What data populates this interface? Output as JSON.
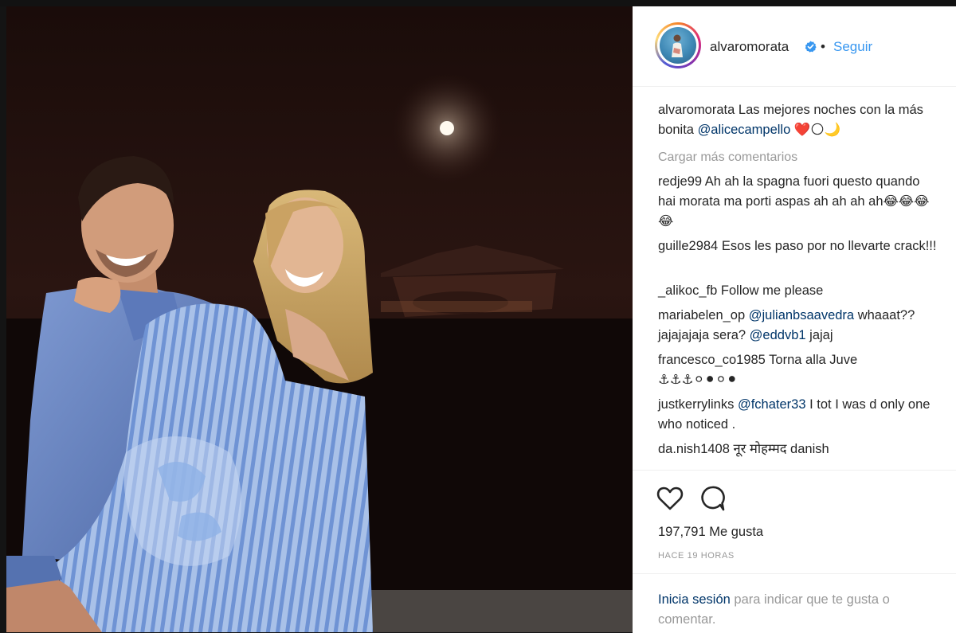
{
  "post": {
    "username": "alvaromorata",
    "follow_label": "Seguir",
    "separator": "•",
    "caption": {
      "user": "alvaromorata",
      "text_before": "Las mejores noches con la más bonita",
      "mention": "@alicecampello",
      "text_after": "❤️🌕🌙"
    },
    "load_more_label": "Cargar más comentarios",
    "likes_label": "197,791 Me gusta",
    "time_label": "HACE 19 HORAS",
    "login_link": "Inicia sesión",
    "login_rest": "para indicar que te gusta o comentar."
  },
  "comments": [
    {
      "user": "redje99",
      "text": "Ah ah la spagna fuori questo quando hai morata ma porti aspas ah ah ah ah😂😂😂😂"
    },
    {
      "user": "guille2984",
      "text": "Esos les paso por no llevarte crack!!!"
    },
    {
      "user": "_alikoc_fb",
      "text": "Follow me please"
    },
    {
      "user": "mariabelen_op",
      "mention1": "@julianbsaavedra",
      "text1": "whaaat?? jajajajaja sera?",
      "mention2": "@eddvb1",
      "text2": "jajaj"
    },
    {
      "user": "francesco_co1985",
      "text": "Torna alla Juve ⚓⚓⚓⚪⚫⚪⚫"
    },
    {
      "user": "justkerrylinks",
      "mention": "@fchater33",
      "text": "I tot I was d only one who noticed ."
    },
    {
      "user": "da.nish1408",
      "text": "नूर मोहम्मद danish"
    },
    {
      "user": "",
      "mention": "",
      "text": ""
    }
  ],
  "icons": {
    "like": "heart-outline-icon",
    "comment": "speech-bubble-icon",
    "verified": "verified-badge-icon"
  },
  "colors": {
    "link_blue": "#3897f0",
    "mention": "#003569",
    "verified": "#3897f0",
    "secondary_text": "#999999"
  }
}
